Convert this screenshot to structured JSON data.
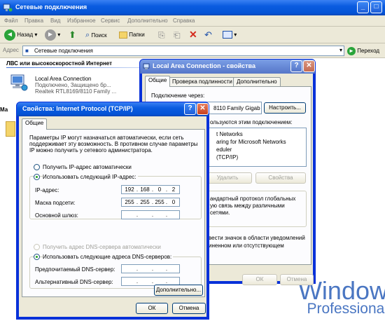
{
  "explorer": {
    "title": "Сетевые подключения",
    "menu": [
      "Файл",
      "Правка",
      "Вид",
      "Избранное",
      "Сервис",
      "Дополнительно",
      "Справка"
    ],
    "toolbar": {
      "back": "Назад",
      "search": "Поиск",
      "folders": "Папки"
    },
    "address": {
      "label": "Адрес",
      "value": "Сетевые подключения",
      "go": "Переход"
    },
    "group_header": "ЛВС или высокоскоростной Интернет",
    "group_header_2": "Ма",
    "connection": {
      "name": "Local Area Connection",
      "status": "Подключено, Защищено бр...",
      "device": "Realtek RTL8169/8110 Family ..."
    },
    "watermark": {
      "line1": "Window",
      "line2": "Professional"
    }
  },
  "lac_dialog": {
    "title": "Local Area Connection - свойства",
    "tabs": [
      "Общие",
      "Проверка подлинности",
      "Дополнительно"
    ],
    "connect_using_label": "Подключение через:",
    "adapter": "8110 Family Gigab",
    "configure_button": "Настроить...",
    "components_label": "ользуются этим подключением:",
    "components": [
      "t Networks",
      "aring for Microsoft Networks",
      "eduler",
      "(TCP/IP)"
    ],
    "remove_button": "Удалить",
    "properties_button": "Свойства",
    "description": [
      "андартный протокол глобальных",
      "ую связь между различными",
      "сетями."
    ],
    "option_lines": [
      "вести значок в области уведомлений",
      "иненном или отсутствующем"
    ],
    "ok_button": "ОК",
    "cancel_button": "Отмена"
  },
  "tcp_dialog": {
    "title": "Свойства: Internet Protocol (TCP/IP)",
    "tab": "Общие",
    "description": [
      "Параметры IP могут назначаться автоматически, если сеть",
      "поддерживает эту возможность. В противном случае параметры",
      "IP можно получить у сетевого администратора."
    ],
    "auto_ip": "Получить IP-адрес автоматически",
    "manual_ip": "Использовать следующий IP-адрес:",
    "ip_label": "IP-адрес:",
    "ip_value": [
      "192",
      "168",
      "0",
      "2"
    ],
    "mask_label": "Маска подсети:",
    "mask_value": [
      "255",
      "255",
      "255",
      "0"
    ],
    "gateway_label": "Основной шлюз:",
    "auto_dns": "Получить адрес DNS-сервера автоматически",
    "manual_dns": "Использовать следующие адреса DNS-серверов:",
    "preferred_dns_label": "Предпочитаемый DNS-сервер:",
    "alternate_dns_label": "Альтернативный DNS-сервер:",
    "advanced_button": "Дополнительно...",
    "ok_button": "ОК",
    "cancel_button": "Отмена"
  },
  "colors": {
    "xp_blue": "#0a5ce0",
    "dialog_face": "#ece9d8",
    "close_red": "#c8401c"
  }
}
